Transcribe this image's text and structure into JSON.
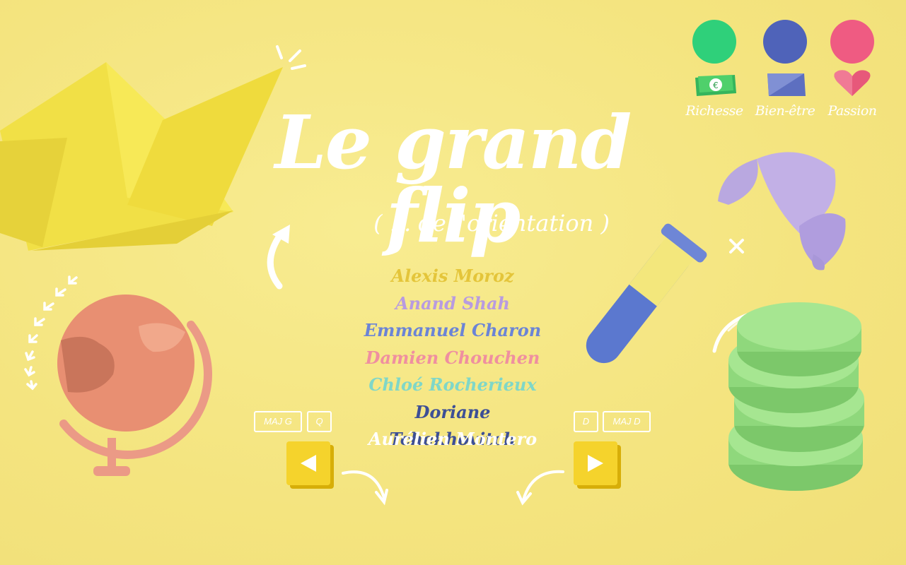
{
  "stats": [
    {
      "label": "Richesse",
      "orb_color": "#2fd07a",
      "icon": "euro-banknote-icon"
    },
    {
      "label": "Bien-être",
      "orb_color": "#4f63b9",
      "icon": "pillow-icon"
    },
    {
      "label": "Passion",
      "orb_color": "#ef5b82",
      "icon": "heart-icon"
    }
  ],
  "title": "Le grand flip",
  "subtitle": "( ... de l'orientation )",
  "credits": [
    {
      "name": "Alexis Moroz",
      "color": "#e4c53a"
    },
    {
      "name": "Anand Shah",
      "color": "#b89be0"
    },
    {
      "name": "Emmanuel Charon",
      "color": "#6b84d6"
    },
    {
      "name": "Damien Chouchen",
      "color": "#ef8fa0"
    },
    {
      "name": "Chloé Rocherieux",
      "color": "#7fd7c8"
    },
    {
      "name": "Doriane Tchekhovitch",
      "color": "#3d4f96"
    },
    {
      "name": "Aurélien Montero",
      "color": "#ffffff"
    }
  ],
  "controls": {
    "left_keys": [
      "MAJ G",
      "Q"
    ],
    "right_keys": [
      "D",
      "MAJ D"
    ]
  },
  "decorations": [
    "paper-boat-icon",
    "globe-icon",
    "test-tube-icon",
    "croissant-icon",
    "coin-stack-icon",
    "curved-arrow-icon"
  ]
}
